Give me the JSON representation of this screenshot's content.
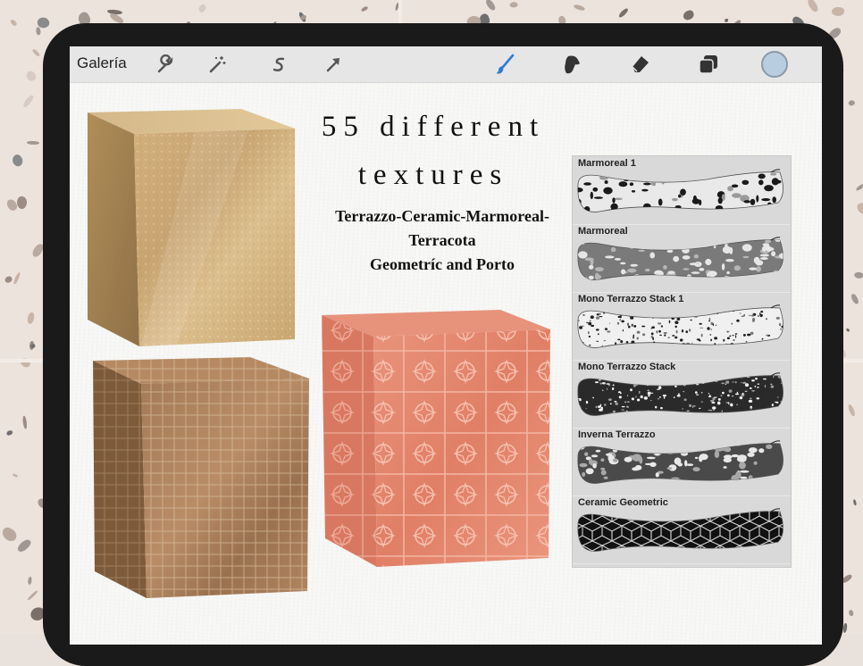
{
  "toolbar": {
    "gallery_label": "Galería",
    "left_icons": [
      "wrench-icon",
      "magic-wand-icon",
      "selection-s-icon",
      "arrow-transform-icon"
    ],
    "right_icons": [
      "brush-icon",
      "smudge-icon",
      "eraser-icon",
      "layers-icon"
    ],
    "color_swatch": "#b9cde0",
    "accent": "#2f7bd6"
  },
  "headline": {
    "line1": "55 different",
    "line2": "textures",
    "subtitle_line1": "Terrazzo-Ceramic-Marmoreal-",
    "subtitle_line2": "Terracota",
    "subtitle_line3": "Geometríc  and Porto"
  },
  "brushes": [
    {
      "name": "Marmoreal 1"
    },
    {
      "name": "Marmoreal"
    },
    {
      "name": "Mono Terrazzo Stack  1"
    },
    {
      "name": "Mono Terrazzo Stack"
    },
    {
      "name": "Inverna Terrazzo"
    },
    {
      "name": "Ceramic Geometric"
    }
  ],
  "colors": {
    "sand_cube": "#c9a877",
    "tile_cube": "#9a7250",
    "terracotta_cube": "#e48a72"
  }
}
